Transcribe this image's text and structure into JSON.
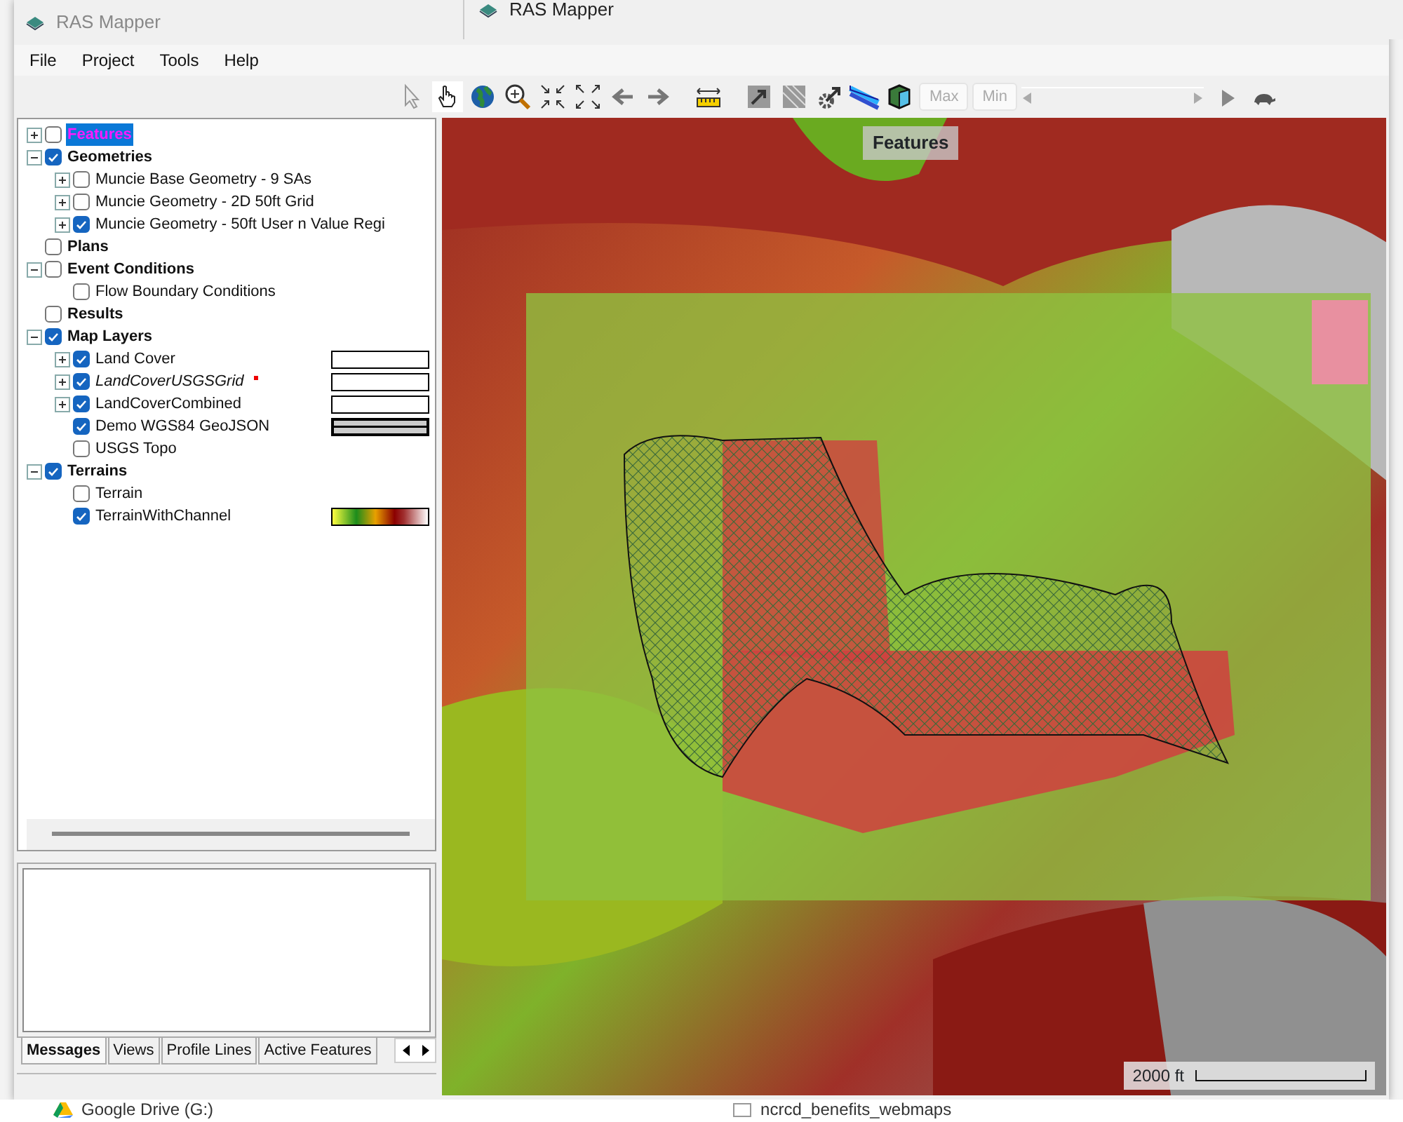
{
  "background_window": {
    "title": "RAS Mapper"
  },
  "taskbar_items": [
    "Google Drive (G:)",
    "ncrcd_benefits_webmaps"
  ],
  "window": {
    "title": "RAS Mapper"
  },
  "menu": [
    "File",
    "Project",
    "Tools",
    "Help"
  ],
  "toolbar": {
    "tools": [
      {
        "kind": "pointer",
        "selected": false
      },
      {
        "kind": "hand",
        "selected": true
      },
      {
        "kind": "globe",
        "selected": false
      },
      {
        "kind": "zoom",
        "selected": false
      },
      {
        "kind": "shrink",
        "selected": false
      },
      {
        "kind": "expand",
        "selected": false
      },
      {
        "kind": "back",
        "selected": false
      },
      {
        "kind": "forward",
        "selected": false
      },
      {
        "kind": "ruler",
        "selected": false
      },
      {
        "kind": "arrow-tile",
        "selected": false
      },
      {
        "kind": "hatch-tile",
        "selected": false
      },
      {
        "kind": "gear-arrow",
        "selected": false
      },
      {
        "kind": "stripe",
        "selected": false
      },
      {
        "kind": "cube",
        "selected": false
      }
    ],
    "range_buttons": [
      {
        "label": "Max",
        "disabled": true
      },
      {
        "label": "Min",
        "disabled": true
      }
    ]
  },
  "tree": [
    {
      "label": "Features",
      "group": true,
      "checked": false,
      "expanded": false,
      "selected": true
    },
    {
      "label": "Geometries",
      "group": true,
      "checked": true,
      "expanded": true,
      "selected": false,
      "children": [
        {
          "label": "Muncie Base Geometry - 9 SAs",
          "checked": false,
          "expanded": false,
          "selected": false
        },
        {
          "label": "Muncie Geometry - 2D 50ft Grid",
          "checked": false,
          "expanded": false,
          "selected": false
        },
        {
          "label": "Muncie Geometry - 50ft User n Value Regi",
          "checked": true,
          "expanded": false,
          "selected": false
        }
      ]
    },
    {
      "label": "Plans",
      "group": true,
      "checked": false,
      "selected": false
    },
    {
      "label": "Event Conditions",
      "group": true,
      "checked": false,
      "expanded": true,
      "selected": false,
      "children": [
        {
          "label": "Flow Boundary Conditions",
          "checked": false,
          "selected": false
        }
      ]
    },
    {
      "label": "Results",
      "group": true,
      "checked": false,
      "selected": false
    },
    {
      "label": "Map Layers",
      "group": true,
      "checked": true,
      "expanded": true,
      "selected": false,
      "children": [
        {
          "label": "Land Cover",
          "checked": true,
          "expanded": false,
          "selected": false,
          "swatch": {
            "kind": "blank"
          }
        },
        {
          "label": "LandCoverUSGSGrid",
          "italic": true,
          "modified": true,
          "checked": true,
          "expanded": false,
          "selected": false,
          "swatch": {
            "kind": "blank"
          }
        },
        {
          "label": "LandCoverCombined",
          "checked": true,
          "expanded": false,
          "selected": false,
          "swatch": {
            "kind": "blank"
          }
        },
        {
          "label": "Demo WGS84 GeoJSON",
          "checked": true,
          "selected": false,
          "swatch": {
            "kind": "outline"
          }
        },
        {
          "label": "USGS Topo",
          "checked": false,
          "selected": false
        }
      ]
    },
    {
      "label": "Terrains",
      "group": true,
      "checked": true,
      "expanded": true,
      "selected": false,
      "children": [
        {
          "label": "Terrain",
          "checked": false,
          "selected": false
        },
        {
          "label": "TerrainWithChannel",
          "checked": true,
          "selected": false,
          "swatch": {
            "kind": "gradient"
          }
        }
      ]
    }
  ],
  "message_tabs": [
    {
      "label": "Messages",
      "selected": true
    },
    {
      "label": "Views",
      "selected": false
    },
    {
      "label": "Profile Lines",
      "selected": false
    },
    {
      "label": "Active Features",
      "selected": false
    }
  ],
  "map": {
    "title": "Features",
    "scale_label": "2000 ft"
  }
}
